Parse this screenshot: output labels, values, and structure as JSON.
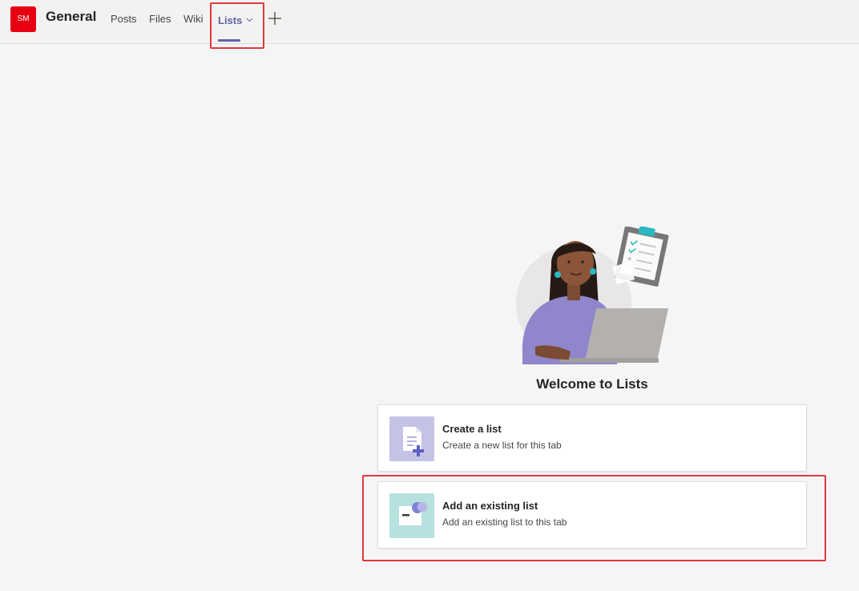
{
  "header": {
    "avatar_initials": "SM",
    "channel_title": "General",
    "tabs": [
      {
        "label": "Posts"
      },
      {
        "label": "Files"
      },
      {
        "label": "Wiki"
      },
      {
        "label": "Lists",
        "active": true
      }
    ],
    "add_tab_icon": "plus-icon"
  },
  "main": {
    "welcome_title": "Welcome to Lists",
    "cards": [
      {
        "title": "Create a list",
        "description": "Create a new list for this tab",
        "icon": "create-list-icon"
      },
      {
        "title": "Add an existing list",
        "description": "Add an existing list to this tab",
        "icon": "existing-list-icon"
      }
    ]
  },
  "colors": {
    "accent": "#6264a7",
    "avatar": "#e60012",
    "highlight": "#e0383e"
  }
}
